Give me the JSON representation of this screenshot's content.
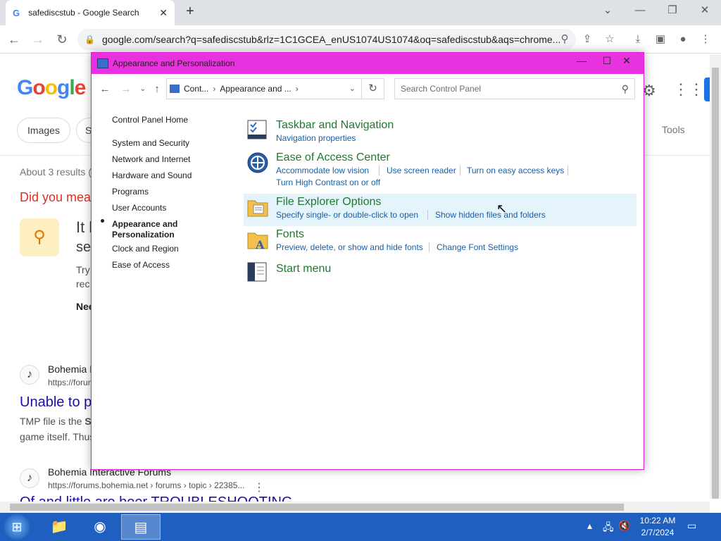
{
  "browser": {
    "tab_title": "safediscstub - Google Search",
    "tab_favicon": "G",
    "url": "google.com/search?q=safediscstub&rlz=1C1GCEA_enUS1074US1074&oq=safediscstub&aqs=chrome..."
  },
  "google": {
    "logo_letters": [
      "G",
      "o",
      "o",
      "g",
      "l",
      "e"
    ],
    "chip_images": "Images",
    "chip_partial": "S",
    "tools": "Tools",
    "about": "About 3 results (",
    "did_you_mean": "Did you mea",
    "suggest_title_1": "It l",
    "suggest_title_2": "se",
    "suggest_try_1": "Try",
    "suggest_try_2": "rec",
    "suggest_need": "Nee",
    "result1_site": "Bohemia I",
    "result1_url": "https://forun",
    "result1_title": "Unable to p",
    "result1_snip1_a": "TMP file is the ",
    "result1_snip1_b": "S",
    "result1_snip2": "game itself. Thus",
    "result2_site": "Bohemia Interactive Forums",
    "result2_url": "https://forums.bohemia.net › forums › topic › 22385...",
    "result2_title": "Of and little are beer TROUBLESHOOTING"
  },
  "controlPanel": {
    "window_title": "Appearance and Personalization",
    "breadcrumb": [
      "Cont...",
      "Appearance and ..."
    ],
    "search_placeholder": "Search Control Panel",
    "left_nav": {
      "home": "Control Panel Home",
      "items": [
        "System and Security",
        "Network and Internet",
        "Hardware and Sound",
        "Programs",
        "User Accounts",
        "Appearance and Personalization",
        "Clock and Region",
        "Ease of Access"
      ],
      "current_index": 5
    },
    "categories": [
      {
        "title": "Taskbar and Navigation",
        "links": [
          "Navigation properties"
        ]
      },
      {
        "title": "Ease of Access Center",
        "links": [
          "Accommodate low vision",
          "Use screen reader",
          "Turn on easy access keys",
          "Turn High Contrast on or off"
        ]
      },
      {
        "title": "File Explorer Options",
        "links": [
          "Specify single- or double-click to open",
          "Show hidden files and folders"
        ]
      },
      {
        "title": "Fonts",
        "links": [
          "Preview, delete, or show and hide fonts",
          "Change Font Settings"
        ]
      },
      {
        "title": "Start menu",
        "links": []
      }
    ]
  },
  "taskbar": {
    "time": "10:22 AM",
    "date": "2/7/2024"
  },
  "colors": {
    "title_bar": "#e832df",
    "category_green": "#1e7a2e",
    "link_blue": "#1a5ea8",
    "taskbar": "#1f5fbf"
  }
}
